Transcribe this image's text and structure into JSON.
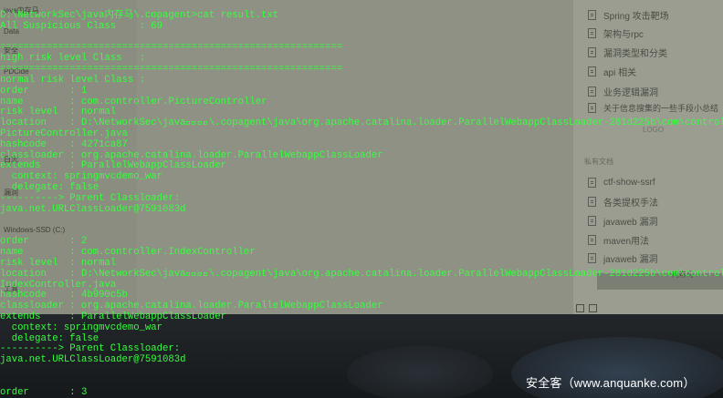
{
  "background_app": {
    "left_items": [
      "java内存马",
      "Data",
      "安全",
      "PDCide",
      "日志",
      "漏洞",
      "Windows-SSD (C:)",
      "工具"
    ],
    "right_items": [
      "Spring 攻击靶场",
      "架构与rpc",
      "漏洞类型和分类",
      "api 相关",
      "业务逻辑漏洞",
      "关于信息搜集的一些手段小总结",
      "ctf-show-ssrf",
      "各类提权手法",
      "javaweb 漏洞",
      "maven用法",
      "javaweb 漏洞"
    ],
    "right_section_label": "私有文档",
    "right_sub_label": "LOGO",
    "scroll_text": "内存马"
  },
  "terminal": {
    "lines": [
      "D:\\NetworkSec\\java内存马\\.copagent>cat result.txt",
      "All Suspicious Class    : 69",
      "",
      "===========================================================",
      "high risk level Class   :",
      "===========================================================",
      "normal risk level Class :",
      "order       : 1",
      "name        : com.controller.PictureController",
      "risk level  : normal",
      "location    : D:\\NetworkSec\\java\u0000\u0000\u0000\u0000\\.copagent\\java\\org.apache.catalina.loader.ParallelWebappClassLoader-281d225b\\com\\controller\\",
      "PictureController.java",
      "hashcode    : 4271ca87",
      "classloader : org.apache.catalina.loader.ParallelWebappClassLoader",
      "extends     : ParallelWebappClassLoader",
      "  context: springmvcdemo_war",
      "  delegate: false",
      "----------> Parent Classloader:",
      "java.net.URLClassLoader@7591083d",
      "",
      "",
      "order       : 2",
      "name        : com.controller.IndexController",
      "risk level  : normal",
      "location    : D:\\NetworkSec\\java\u0000\u0000\u0000\u0000\\.copagent\\java\\org.apache.catalina.loader.ParallelWebappClassLoader-281d225b\\com\\controller\\",
      "IndexController.java",
      "hashcode    : 4b990c5b",
      "classloader : org.apache.catalina.loader.ParallelWebappClassLoader",
      "extends     : ParallelWebappClassLoader",
      "  context: springmvcdemo_war",
      "  delegate: false",
      "----------> Parent Classloader:",
      "java.net.URLClassLoader@7591083d",
      "",
      "",
      "order       : 3"
    ]
  },
  "watermark": "安全客（www.anquanke.com）",
  "colors": {
    "terminal_text": "#37ff3f",
    "watermark": "#ffffff"
  }
}
